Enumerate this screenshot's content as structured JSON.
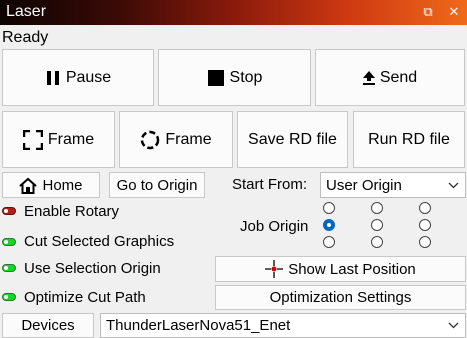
{
  "window": {
    "title": "Laser",
    "restore_glyph": "⧉",
    "close_glyph": "✕"
  },
  "status": "Ready",
  "buttons": {
    "pause": "Pause",
    "stop": "Stop",
    "send": "Send",
    "frame_rect": "Frame",
    "frame_circle": "Frame",
    "save_rd": "Save RD file",
    "run_rd": "Run RD file",
    "home": "Home",
    "go_to_origin": "Go to Origin",
    "show_last_position": "Show Last Position",
    "optimization_settings": "Optimization Settings",
    "devices": "Devices"
  },
  "start_from": {
    "label": "Start From:",
    "value": "User Origin"
  },
  "job_origin": {
    "label": "Job Origin",
    "selected": "middle-left"
  },
  "toggles": [
    {
      "label": "Enable Rotary",
      "on": false
    },
    {
      "label": "Cut Selected Graphics",
      "on": true
    },
    {
      "label": "Use Selection Origin",
      "on": true
    },
    {
      "label": "Optimize Cut Path",
      "on": true
    }
  ],
  "device_select": {
    "value": "ThunderLaserNova51_Enet"
  },
  "colors": {
    "toggle_on": "#17d52a",
    "toggle_off": "#b0201a",
    "radio_accent": "#0067c0",
    "crosshair": "#d00000"
  }
}
